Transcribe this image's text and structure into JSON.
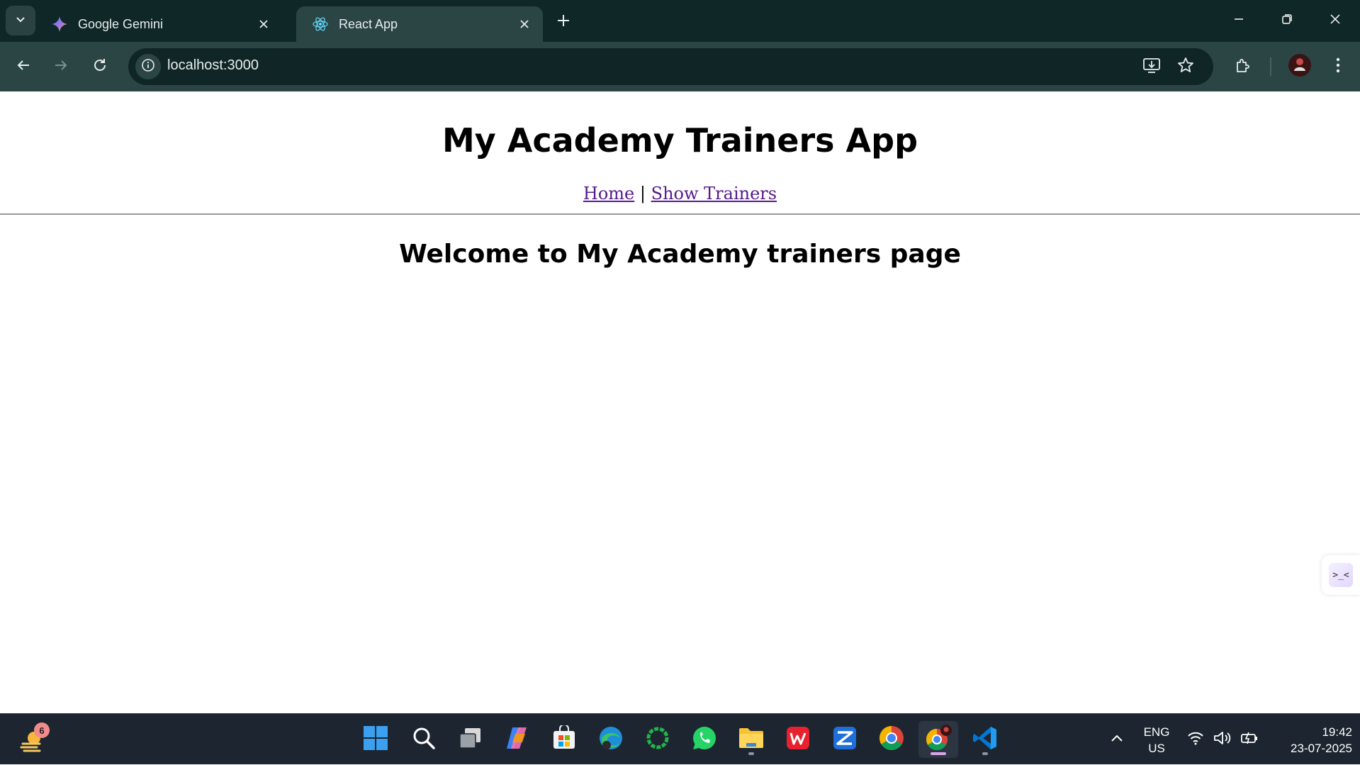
{
  "browser": {
    "tabs": [
      {
        "title": "Google Gemini",
        "icon": "gemini-icon",
        "active": false
      },
      {
        "title": "React App",
        "icon": "react-icon",
        "active": true
      }
    ],
    "url": "localhost:3000"
  },
  "page": {
    "title": "My Academy Trainers App",
    "nav": {
      "home": "Home",
      "separator": "|",
      "show_trainers": "Show Trainers"
    },
    "welcome": "Welcome to My Academy trainers page",
    "side_widget_glyph": ">_<"
  },
  "taskbar": {
    "weather_badge": "6",
    "lang_line1": "ENG",
    "lang_line2": "US",
    "time": "19:42",
    "date": "23-07-2025"
  },
  "colors": {
    "tabstrip_bg": "#0f2727",
    "toolbar_bg": "#2b4545",
    "link": "#551a8b",
    "taskbar_bg": "#1c2530"
  }
}
